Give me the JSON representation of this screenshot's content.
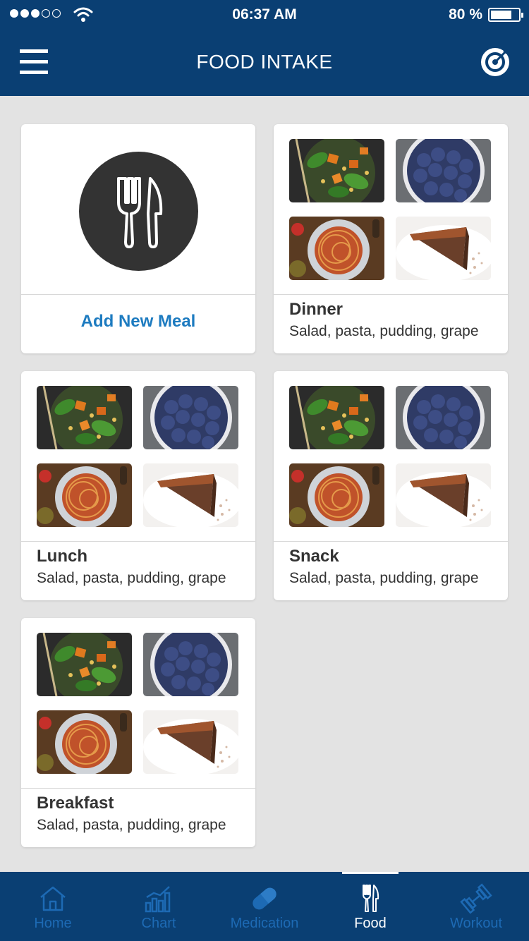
{
  "status_bar": {
    "time": "06:37 AM",
    "battery": "80 %"
  },
  "header": {
    "title": "FOOD INTAKE"
  },
  "add_card": {
    "label": "Add New Meal"
  },
  "meals": [
    {
      "name": "Dinner",
      "description": "Salad, pasta, pudding, grape"
    },
    {
      "name": "Lunch",
      "description": "Salad, pasta, pudding, grape"
    },
    {
      "name": "Snack",
      "description": "Salad, pasta, pudding, grape"
    },
    {
      "name": "Breakfast",
      "description": "Salad, pasta, pudding, grape"
    }
  ],
  "tabs": [
    {
      "label": "Home",
      "icon": "home-icon"
    },
    {
      "label": "Chart",
      "icon": "chart-icon"
    },
    {
      "label": "Medication",
      "icon": "pill-icon"
    },
    {
      "label": "Food",
      "icon": "fork-knife-icon",
      "active": true
    },
    {
      "label": "Workout",
      "icon": "dumbbell-icon"
    }
  ],
  "colors": {
    "header": "#0a3f73",
    "accent": "#1d7bc0",
    "background": "#e3e3e3"
  }
}
